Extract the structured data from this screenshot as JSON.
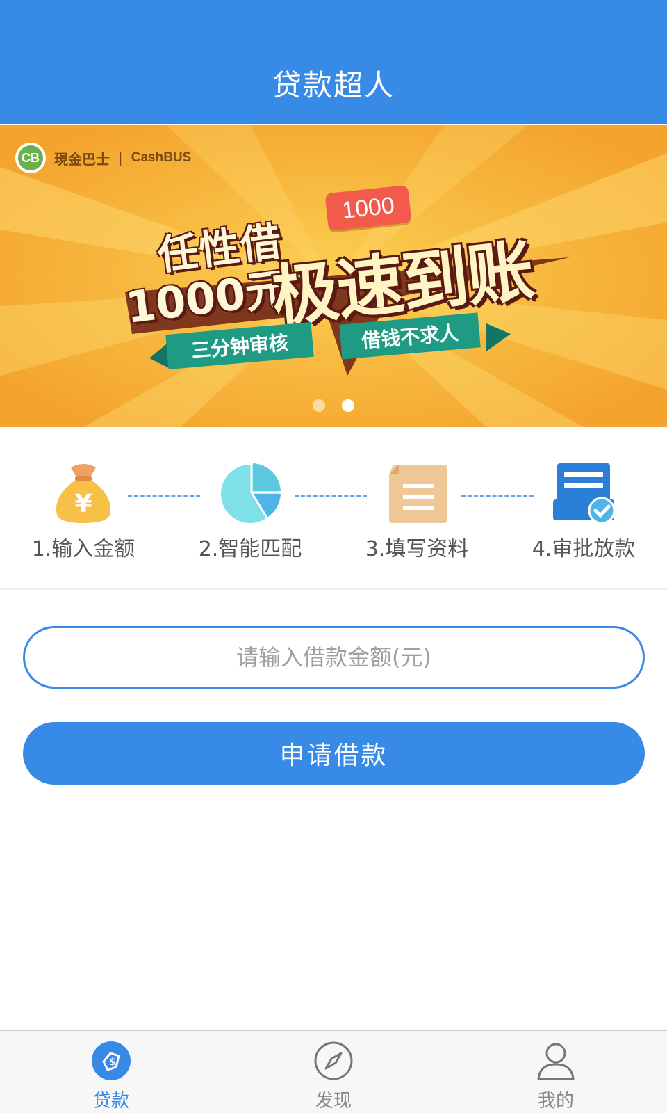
{
  "header": {
    "title": "贷款超人"
  },
  "banner": {
    "logo_cn": "現金巴士",
    "logo_sep": "|",
    "logo_en": "CashBUS",
    "logo_mark": "CB",
    "tag_amount": "1000",
    "line1": "任性借",
    "line2": "1000元",
    "big": "极速到账",
    "ribbon_left": "三分钟审核",
    "ribbon_right": "借钱不求人",
    "slide_count": 2,
    "active_slide": 2
  },
  "steps": [
    {
      "label": "1.输入金额",
      "icon": "money-bag-icon"
    },
    {
      "label": "2.智能匹配",
      "icon": "pie-chart-icon"
    },
    {
      "label": "3.填写资料",
      "icon": "document-icon"
    },
    {
      "label": "4.审批放款",
      "icon": "approval-icon"
    }
  ],
  "form": {
    "amount_placeholder": "请输入借款金额(元)",
    "amount_value": "",
    "apply_label": "申请借款"
  },
  "tabbar": {
    "items": [
      {
        "label": "贷款",
        "icon": "loan-icon",
        "active": true
      },
      {
        "label": "发现",
        "icon": "compass-icon",
        "active": false
      },
      {
        "label": "我的",
        "icon": "user-icon",
        "active": false
      }
    ]
  },
  "colors": {
    "primary": "#378ae6",
    "banner_bg": "#f7b63c",
    "ribbon": "#1f9b84",
    "tag": "#f25a4c"
  }
}
